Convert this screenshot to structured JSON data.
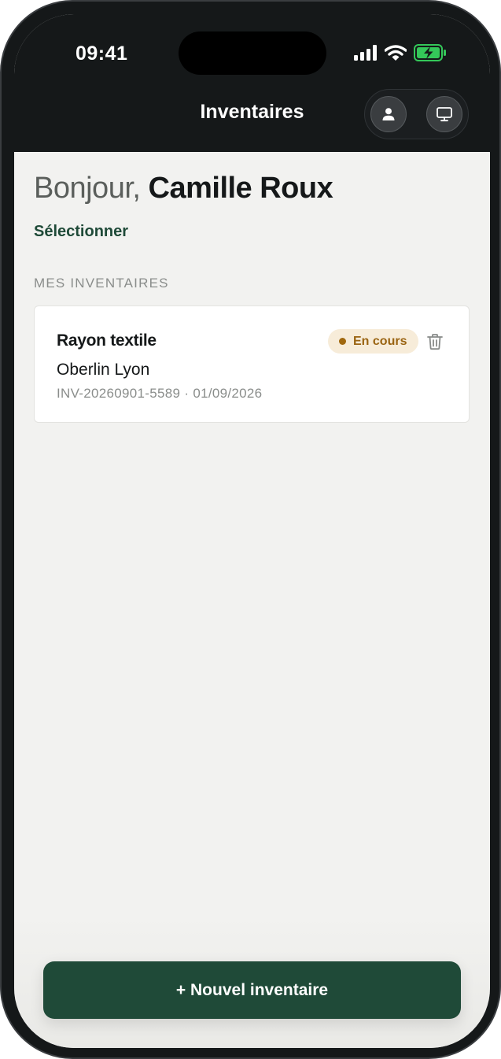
{
  "status_bar": {
    "time": "09:41",
    "icons": [
      "cellular-signal-icon",
      "wifi-icon",
      "battery-charging-icon"
    ]
  },
  "header": {
    "title": "Inventaires",
    "actions": [
      "user-icon",
      "monitor-icon"
    ]
  },
  "greeting": {
    "prefix": "Bonjour,",
    "name": "Camille Roux"
  },
  "select_link": "Sélectionner",
  "section_label": "MES INVENTAIRES",
  "inventories": [
    {
      "title": "Rayon textile",
      "location": "Oberlin Lyon",
      "reference": "INV-20260901-5589",
      "separator": "·",
      "date": "01/09/2026",
      "status": "En cours"
    }
  ],
  "primary_action": "+ Nouvel inventaire",
  "colors": {
    "brand": "#1f4a38",
    "header_bg": "#151819",
    "background": "#f2f2f0",
    "status_badge_bg": "#f7ecd9",
    "status_badge_text": "#9a6412",
    "battery_green": "#34c759"
  }
}
